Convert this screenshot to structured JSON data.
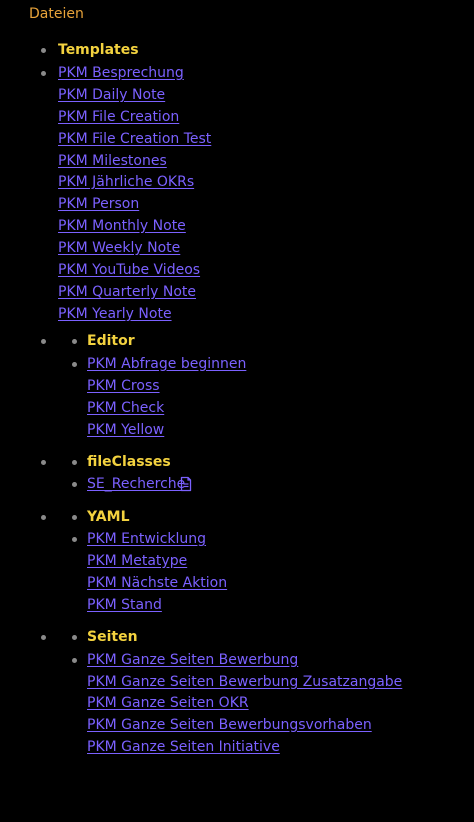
{
  "heading": "Dateien",
  "colors": {
    "heading": "#e8a33a",
    "section_title": "#f3d23f",
    "link": "#7b61ff",
    "bullet": "#8a8a8a",
    "background": "#000000"
  },
  "templates": {
    "title": "Templates",
    "links": [
      "PKM Besprechung",
      "PKM Daily Note",
      "PKM File Creation",
      "PKM File Creation Test",
      "PKM Milestones",
      "PKM Jährliche OKRs",
      "PKM Person",
      "PKM Monthly Note",
      "PKM Weekly Note",
      "PKM YouTube Videos",
      "PKM Quarterly Note",
      "PKM Yearly Note"
    ]
  },
  "editor": {
    "title": "Editor",
    "links": [
      "PKM Abfrage beginnen",
      "PKM Cross",
      "PKM Check",
      "PKM Yellow"
    ]
  },
  "fileclasses": {
    "title": "fileClasses",
    "links": [
      "SE_Recherche"
    ],
    "icon": "file-text-icon"
  },
  "yaml": {
    "title": "YAML",
    "links": [
      "PKM Entwicklung",
      "PKM Metatype",
      "PKM Nächste Aktion",
      "PKM Stand"
    ]
  },
  "seiten": {
    "title": "Seiten",
    "links": [
      "PKM Ganze Seiten Bewerbung",
      "PKM Ganze Seiten Bewerbung Zusatzangabe",
      "PKM Ganze Seiten OKR",
      "PKM Ganze Seiten Bewerbungsvorhaben",
      "PKM Ganze Seiten Initiative"
    ]
  }
}
